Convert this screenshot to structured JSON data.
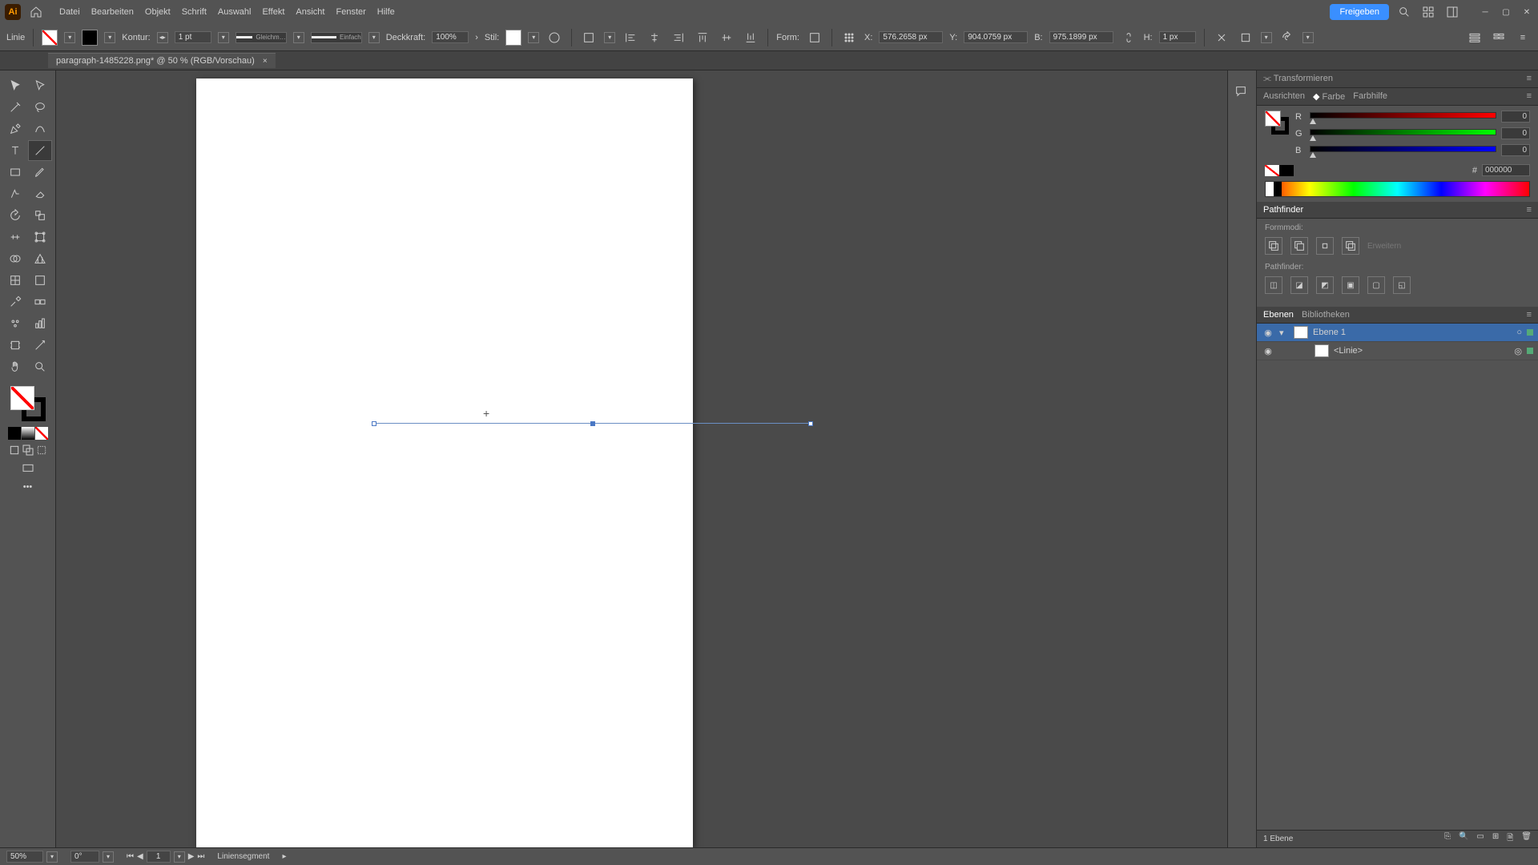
{
  "app": {
    "logo_text": "Ai"
  },
  "menu": [
    "Datei",
    "Bearbeiten",
    "Objekt",
    "Schrift",
    "Auswahl",
    "Effekt",
    "Ansicht",
    "Fenster",
    "Hilfe"
  ],
  "share_label": "Freigeben",
  "controlbar": {
    "type_label": "Linie",
    "stroke_label": "Kontur:",
    "stroke_weight": "1 pt",
    "profile_label": "Gleichm…",
    "brush_label": "Einfach",
    "opacity_label": "Deckkraft:",
    "opacity_value": "100%",
    "style_label": "Stil:",
    "shape_label": "Form:",
    "x_label": "X:",
    "x_value": "576.2658 px",
    "y_label": "Y:",
    "y_value": "904.0759 px",
    "w_label": "B:",
    "w_value": "975.1899 px",
    "h_label": "H:",
    "h_value": "1 px"
  },
  "tab": {
    "title": "paragraph-1485228.png* @ 50 % (RGB/Vorschau)",
    "close": "×"
  },
  "panels": {
    "transform": "Transformieren",
    "align": "Ausrichten",
    "color": "Farbe",
    "color_guide": "Farbhilfe",
    "r_label": "R",
    "g_label": "G",
    "b_label": "B",
    "r_val": "0",
    "g_val": "0",
    "b_val": "0",
    "hex_prefix": "#",
    "hex_value": "000000",
    "pathfinder": "Pathfinder",
    "shapemodes": "Formmodi:",
    "pathfinders": "Pathfinder:",
    "expand": "Erweitern",
    "layers": "Ebenen",
    "libraries": "Bibliotheken",
    "layer1": "Ebene 1",
    "sublayer": "<Linie>",
    "layer_count": "1 Ebene"
  },
  "status": {
    "zoom": "50%",
    "rotation": "0°",
    "artboard": "1",
    "tool": "Liniensegment"
  }
}
